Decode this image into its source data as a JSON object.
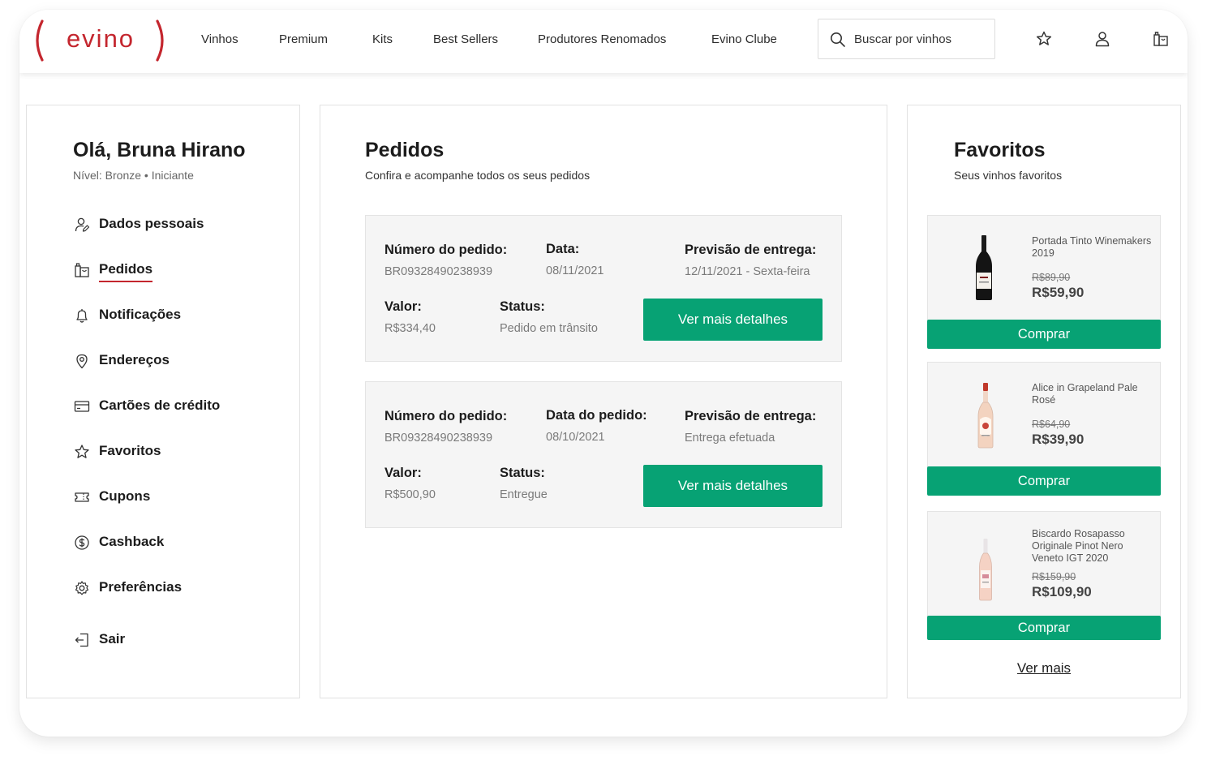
{
  "brand": {
    "logo_text": "evino",
    "color": "#c4262e",
    "accent_green": "#07a274"
  },
  "nav": {
    "items": [
      "Vinhos",
      "Premium",
      "Kits",
      "Best Sellers",
      "Produtores Renomados",
      "Evino Clube"
    ],
    "search_placeholder": "Buscar por vinhos",
    "icons": [
      "star-icon",
      "user-icon",
      "bag-icon"
    ]
  },
  "sidebar": {
    "greeting": "Olá, Bruna Hirano",
    "level": "Nível: Bronze • Iniciante",
    "active": "Pedidos",
    "items": [
      {
        "label": "Dados pessoais",
        "icon": "user-edit-icon"
      },
      {
        "label": "Pedidos",
        "icon": "bag-icon"
      },
      {
        "label": "Notificações",
        "icon": "bell-icon"
      },
      {
        "label": "Endereços",
        "icon": "location-pin-icon"
      },
      {
        "label": "Cartões de crédito",
        "icon": "credit-card-icon"
      },
      {
        "label": "Favoritos",
        "icon": "star-icon"
      },
      {
        "label": "Cupons",
        "icon": "ticket-icon"
      },
      {
        "label": "Cashback",
        "icon": "dollar-coin-icon"
      },
      {
        "label": "Preferências",
        "icon": "gear-icon"
      },
      {
        "label": "Sair",
        "icon": "logout-icon"
      }
    ]
  },
  "orders": {
    "title": "Pedidos",
    "subtitle": "Confira e acompanhe todos os seus pedidos",
    "list": [
      {
        "number_label": "Número do pedido:",
        "number": "BR09328490238939",
        "date_label": "Data:",
        "date": "08/11/2021",
        "delivery_label": "Previsão de entrega:",
        "delivery": "12/11/2021 - Sexta-feira",
        "value_label": "Valor:",
        "value": "R$334,40",
        "status_label": "Status:",
        "status": "Pedido em trânsito",
        "button": "Ver mais detalhes"
      },
      {
        "number_label": "Número do pedido:",
        "number": "BR09328490238939",
        "date_label": "Data do pedido:",
        "date": "08/10/2021",
        "delivery_label": "Previsão de entrega:",
        "delivery": "Entrega efetuada",
        "value_label": "Valor:",
        "value": "R$500,90",
        "status_label": "Status:",
        "status": "Entregue",
        "button": "Ver mais detalhes"
      }
    ]
  },
  "favorites": {
    "title": "Favoritos",
    "subtitle": "Seus vinhos favoritos",
    "items": [
      {
        "name": "Portada Tinto Winemakers 2019",
        "old_price": "R$89,90",
        "price": "R$59,90",
        "button": "Comprar"
      },
      {
        "name": "Alice in Grapeland Pale Rosé",
        "old_price": "R$64,90",
        "price": "R$39,90",
        "button": "Comprar"
      },
      {
        "name": "Biscardo Rosapasso Originale Pinot Nero Veneto IGT 2020",
        "old_price": "R$159,90",
        "price": "R$109,90",
        "button": "Comprar"
      }
    ],
    "see_more": "Ver mais"
  }
}
